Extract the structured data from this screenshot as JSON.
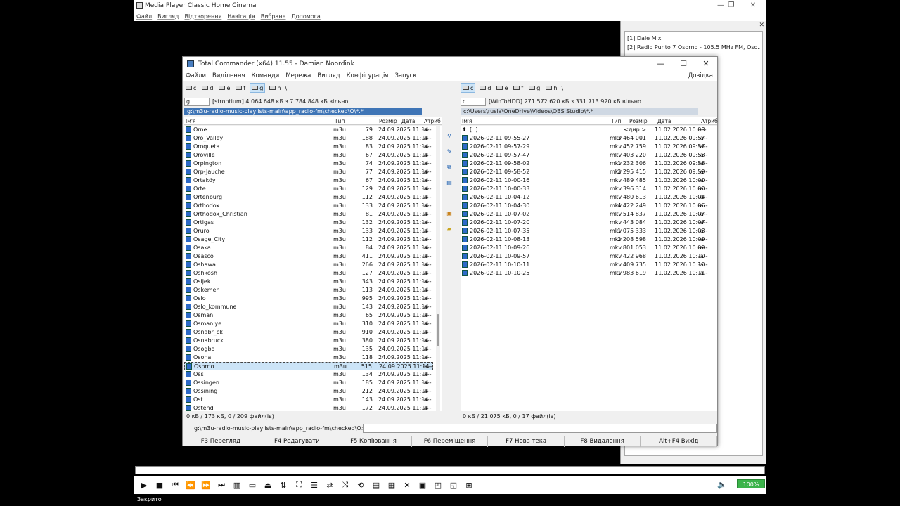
{
  "mpc": {
    "title": "Media Player Classic Home Cinema",
    "menu": [
      "Файл",
      "Вигляд",
      "Відтворення",
      "Навігація",
      "Вибране",
      "Допомога"
    ],
    "playlist": [
      "[1]   Dale Mix",
      "[2]   Radio Punto 7 Osorno - 105.5 MHz FM, Oso..."
    ],
    "status": "Закрито",
    "zoom": "100%",
    "icons": [
      "play-icon",
      "stop-icon",
      "prev-icon",
      "rewind-icon",
      "forward-icon",
      "next-icon",
      "frame-step-icon",
      "aspect-icon",
      "eject-icon",
      "settings-icon",
      "fullscreen-icon",
      "playlist-icon",
      "loop-icon",
      "shuffle-icon",
      "subtitle-icon",
      "chapters-icon",
      "info-icon",
      "close-icon",
      "layout1-icon",
      "layout2-icon",
      "layout3-icon",
      "layout4-icon"
    ],
    "icon_glyphs": [
      "▶",
      "■",
      "⏮",
      "⏪",
      "⏩",
      "⏭",
      "▥",
      "▭",
      "⏏",
      "⇅",
      "⛶",
      "☰",
      "⇄",
      "⤨",
      "⟲",
      "▤",
      "▦",
      "✕",
      "▣",
      "◰",
      "◱",
      "⊞"
    ]
  },
  "tc": {
    "title": "Total Commander (x64) 11.55 - Damian Noordink",
    "menu": [
      "Файли",
      "Виділення",
      "Команди",
      "Мережа",
      "Вигляд",
      "Конфігурація",
      "Запуск"
    ],
    "help": "Довідка",
    "left_drives": [
      "c",
      "d",
      "e",
      "f",
      "g",
      "h"
    ],
    "right_drives": [
      "c",
      "d",
      "e",
      "f",
      "g",
      "h"
    ],
    "left_drive_current": "g",
    "left_drive_info": "[strontium]  4 064 648 кБ з 7 784 848 кБ вільно",
    "right_drive_current": "c",
    "right_drive_info": "[WinToHDD]  271 572 620 кБ з 331 713 920 кБ вільно",
    "left_path": "g:\\m3u-radio-music-playlists-main\\app_radio-fm\\checked\\O\\*.*",
    "right_path": "c:\\Users\\rusla\\OneDrive\\Videos\\OBS Studio\\*.*",
    "columns": {
      "name": "Ім'я",
      "type": "Тип",
      "size": "Розмір",
      "date": "Дата",
      "attr": "Атриб"
    },
    "left_files": [
      [
        "Orne",
        "m3u",
        "79",
        "24.09.2025 11:14",
        "-a--"
      ],
      [
        "Oro_Valley",
        "m3u",
        "188",
        "24.09.2025 11:14",
        "-a--"
      ],
      [
        "Oroqueta",
        "m3u",
        "83",
        "24.09.2025 11:14",
        "-a--"
      ],
      [
        "Oroville",
        "m3u",
        "67",
        "24.09.2025 11:14",
        "-a--"
      ],
      [
        "Orpington",
        "m3u",
        "74",
        "24.09.2025 11:14",
        "-a--"
      ],
      [
        "Orp-Jauche",
        "m3u",
        "77",
        "24.09.2025 11:14",
        "-a--"
      ],
      [
        "Ortaköy",
        "m3u",
        "67",
        "24.09.2025 11:14",
        "-a--"
      ],
      [
        "Orte",
        "m3u",
        "129",
        "24.09.2025 11:14",
        "-a--"
      ],
      [
        "Ortenburg",
        "m3u",
        "112",
        "24.09.2025 11:14",
        "-a--"
      ],
      [
        "Orthodox",
        "m3u",
        "133",
        "24.09.2025 11:14",
        "-a--"
      ],
      [
        "Orthodox_Christian",
        "m3u",
        "81",
        "24.09.2025 11:14",
        "-a--"
      ],
      [
        "Ortigas",
        "m3u",
        "132",
        "24.09.2025 11:14",
        "-a--"
      ],
      [
        "Oruro",
        "m3u",
        "133",
        "24.09.2025 11:14",
        "-a--"
      ],
      [
        "Osage_City",
        "m3u",
        "112",
        "24.09.2025 11:14",
        "-a--"
      ],
      [
        "Osaka",
        "m3u",
        "84",
        "24.09.2025 11:14",
        "-a--"
      ],
      [
        "Osasco",
        "m3u",
        "411",
        "24.09.2025 11:14",
        "-a--"
      ],
      [
        "Oshawa",
        "m3u",
        "266",
        "24.09.2025 11:14",
        "-a--"
      ],
      [
        "Oshkosh",
        "m3u",
        "127",
        "24.09.2025 11:14",
        "-a--"
      ],
      [
        "Osijek",
        "m3u",
        "343",
        "24.09.2025 11:14",
        "-a--"
      ],
      [
        "Oskemen",
        "m3u",
        "113",
        "24.09.2025 11:14",
        "-a--"
      ],
      [
        "Oslo",
        "m3u",
        "995",
        "24.09.2025 11:14",
        "-a--"
      ],
      [
        "Oslo_kommune",
        "m3u",
        "143",
        "24.09.2025 11:14",
        "-a--"
      ],
      [
        "Osman",
        "m3u",
        "65",
        "24.09.2025 11:14",
        "-a--"
      ],
      [
        "Osmaniye",
        "m3u",
        "310",
        "24.09.2025 11:14",
        "-a--"
      ],
      [
        "Osnabr_ck",
        "m3u",
        "910",
        "24.09.2025 11:14",
        "-a--"
      ],
      [
        "Osnabruck",
        "m3u",
        "380",
        "24.09.2025 11:14",
        "-a--"
      ],
      [
        "Osogbo",
        "m3u",
        "135",
        "24.09.2025 11:14",
        "-a--"
      ],
      [
        "Osona",
        "m3u",
        "118",
        "24.09.2025 11:14",
        "-a--"
      ],
      [
        "Osorno",
        "m3u",
        "515",
        "24.09.2025 11:14",
        "-a--"
      ],
      [
        "Oss",
        "m3u",
        "134",
        "24.09.2025 11:14",
        "-a--"
      ],
      [
        "Ossingen",
        "m3u",
        "185",
        "24.09.2025 11:14",
        "-a--"
      ],
      [
        "Ossining",
        "m3u",
        "212",
        "24.09.2025 11:14",
        "-a--"
      ],
      [
        "Ost",
        "m3u",
        "143",
        "24.09.2025 11:14",
        "-a--"
      ],
      [
        "Ostend",
        "m3u",
        "172",
        "24.09.2025 11:14",
        "-a--"
      ]
    ],
    "left_selected_index": 28,
    "right_up": [
      "[..]",
      "",
      "<дир.>",
      "11.02.2026 10:08",
      "----"
    ],
    "right_files": [
      [
        "2026-02-11 09-55-27",
        "mkv",
        "3 464 001",
        "11.02.2026 09:57",
        "-a--"
      ],
      [
        "2026-02-11 09-57-29",
        "mkv",
        "452 759",
        "11.02.2026 09:57",
        "-a--"
      ],
      [
        "2026-02-11 09-57-47",
        "mkv",
        "403 220",
        "11.02.2026 09:58",
        "-a--"
      ],
      [
        "2026-02-11 09-58-02",
        "mkv",
        "1 232 306",
        "11.02.2026 09:58",
        "-a--"
      ],
      [
        "2026-02-11 09-58-52",
        "mkv",
        "2 295 415",
        "11.02.2026 09:59",
        "-a--"
      ],
      [
        "2026-02-11 10-00-16",
        "mkv",
        "489 485",
        "11.02.2026 10:00",
        "-a--"
      ],
      [
        "2026-02-11 10-00-33",
        "mkv",
        "396 314",
        "11.02.2026 10:00",
        "-a--"
      ],
      [
        "2026-02-11 10-04-12",
        "mkv",
        "480 613",
        "11.02.2026 10:04",
        "-a--"
      ],
      [
        "2026-02-11 10-04-30",
        "mkv",
        "4 422 249",
        "11.02.2026 10:06",
        "-a--"
      ],
      [
        "2026-02-11 10-07-02",
        "mkv",
        "514 837",
        "11.02.2026 10:07",
        "-a--"
      ],
      [
        "2026-02-11 10-07-20",
        "mkv",
        "443 084",
        "11.02.2026 10:07",
        "-a--"
      ],
      [
        "2026-02-11 10-07-35",
        "mkv",
        "1 075 333",
        "11.02.2026 10:08",
        "-a--"
      ],
      [
        "2026-02-11 10-08-13",
        "mkv",
        "2 208 598",
        "11.02.2026 10:09",
        "-a--"
      ],
      [
        "2026-02-11 10-09-26",
        "mkv",
        "801 053",
        "11.02.2026 10:09",
        "-a--"
      ],
      [
        "2026-02-11 10-09-57",
        "mkv",
        "422 968",
        "11.02.2026 10:10",
        "-a--"
      ],
      [
        "2026-02-11 10-10-11",
        "mkv",
        "409 735",
        "11.02.2026 10:10",
        "-a--"
      ],
      [
        "2026-02-11 10-10-25",
        "mkv",
        "1 983 619",
        "11.02.2026 10:11",
        "-a--"
      ]
    ],
    "left_summary": "0 кБ / 173 кБ, 0 / 209 файл(ів)",
    "right_summary": "0 кБ / 21 075 кБ, 0 / 17 файл(ів)",
    "cmd_prompt": "g:\\m3u-radio-music-playlists-main\\app_radio-fm\\checked\\O>",
    "fkeys": [
      "F3 Перегляд",
      "F4 Редагувати",
      "F5 Копіювання",
      "F6 Переміщення",
      "F7 Нова тека",
      "F8 Видалення",
      "Alt+F4 Вихід"
    ]
  }
}
